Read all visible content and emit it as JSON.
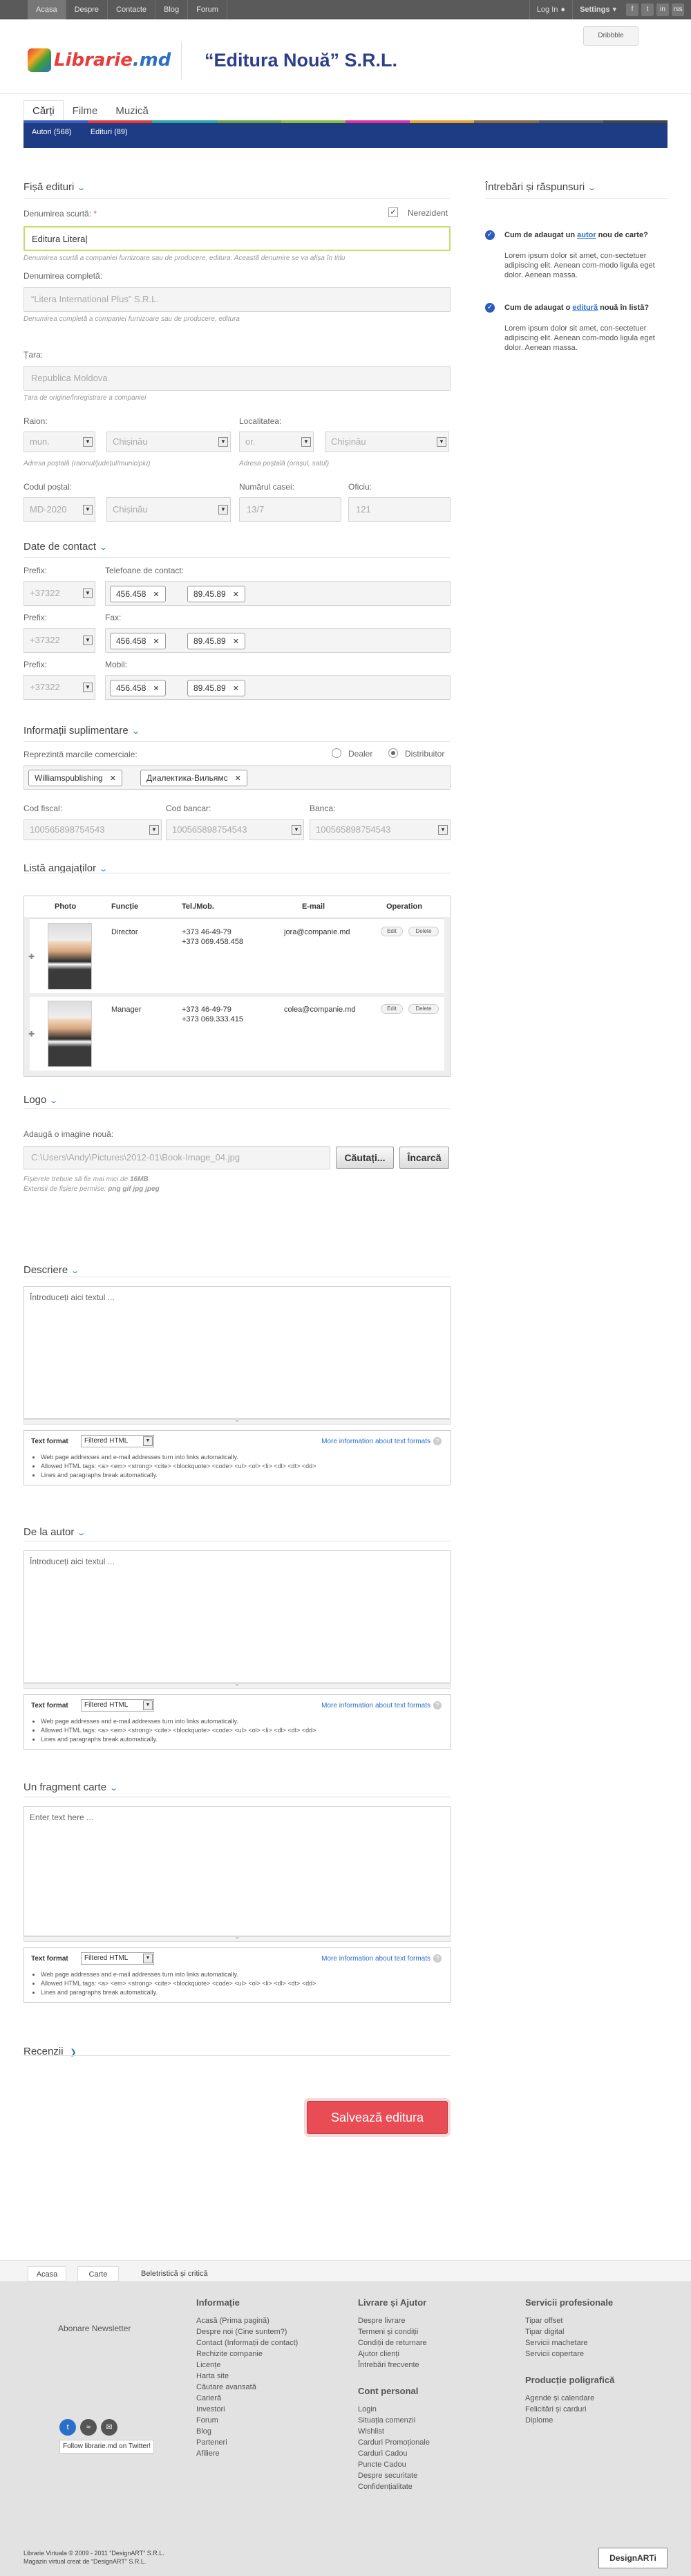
{
  "topnav": [
    "Acasa",
    "Despre",
    "Contacte",
    "Blog",
    "Forum"
  ],
  "topright": {
    "login": "Log In",
    "settings": "Settings",
    "social": [
      "f",
      "t",
      "in",
      "rss"
    ]
  },
  "dribbble": "Dribbble",
  "logo": {
    "a": "Librarie",
    "b": ".md"
  },
  "company": "“Editura Nouă” S.R.L.",
  "tabs": [
    "Cărți",
    "Filme",
    "Muzică"
  ],
  "colorstrip": [
    "#3a5fbf",
    "#e43c3c",
    "#2aa6a6",
    "#6aa544",
    "#8abf3a",
    "#e02fa5",
    "#e8a526",
    "#8b6a3e",
    "#5a5a5a",
    "#444444"
  ],
  "subtabs": [
    "Autori (568)",
    "Edituri (89)"
  ],
  "fisa": {
    "title": "Fișă edituri",
    "short_label": "Denumirea scurtă:",
    "required_mark": "*",
    "rezident": "Nerezident",
    "short_value": "Editura Litera",
    "short_help": "Denumirea scurtă a companiei furnizoare sau de producere, editura. Această denumire se va afișa în titlu",
    "full_label": "Denumirea completă:",
    "full_value": "“Litera International Plus” S.R.L.",
    "full_help": "Denumirea completă a companiei furnizoare sau de producere, editura",
    "country_label": "Țara:",
    "country_value": "Republica Moldova",
    "country_help": "Țara de origine/înregistrare a companiei",
    "raion_label": "Raion:",
    "raion_prefix": "mun.",
    "raion_value": "Chișinău",
    "raion_help": "Adresa poștală (raionul/județul/municipiu)",
    "loc_label": "Localitatea:",
    "loc_prefix": "or.",
    "loc_value": "Chișinău",
    "loc_help": "Adresa poștală (orașul, satul)",
    "postal_label": "Codul poștal:",
    "postal_value": "MD-2020",
    "postal_city": "Chișinău",
    "house_label": "Numărul casei:",
    "house_value": "13/7",
    "office_label": "Oficiu:",
    "office_value": "121"
  },
  "contact": {
    "title": "Date de contact",
    "rows": [
      {
        "prefix_label": "Prefix:",
        "field_label": "Telefoane de contact:",
        "prefix": "+37322",
        "tags": [
          "456.458",
          "89.45.89"
        ]
      },
      {
        "prefix_label": "Prefix:",
        "field_label": "Fax:",
        "prefix": "+37322",
        "tags": [
          "456.458",
          "89.45.89"
        ]
      },
      {
        "prefix_label": "Prefix:",
        "field_label": "Mobil:",
        "prefix": "+37322",
        "tags": [
          "456.458",
          "89.45.89"
        ]
      }
    ]
  },
  "extra": {
    "title": "Informații suplimentare",
    "brands_label": "Reprezintă marcile comerciale:",
    "dealer": "Dealer",
    "distribuitor": "Distribuitor",
    "brands": [
      "Williamspublishing",
      "Диалектика-Вильямс"
    ],
    "fiscal_label": "Cod fiscal:",
    "fiscal_value": "100565898754543",
    "bank_code_label": "Cod bancar:",
    "bank_code_value": "100565898754543",
    "bank_label": "Banca:",
    "bank_value": "100565898754543"
  },
  "employees": {
    "title": "Listă angajaților",
    "headers": [
      "Photo",
      "Funcție",
      "Tel./Mob.",
      "E-mail",
      "Operation"
    ],
    "rows": [
      {
        "role": "Director",
        "tel": "+373 46-49-79",
        "mob": "+373 069.458.458",
        "email": "jora@companie.md",
        "edit": "Edit",
        "delete": "Delete"
      },
      {
        "role": "Manager",
        "tel": "+373 46-49-79",
        "mob": "+373 069.333.415",
        "email": "colea@companie.md",
        "edit": "Edit",
        "delete": "Delete"
      }
    ]
  },
  "logo_sec": {
    "title": "Logo",
    "add_label": "Adaugă o imagine nouă:",
    "file_value": "C:\\Users\\Andy\\Pictures\\2012-01\\Book-Image_04.jpg",
    "browse": "Căutați...",
    "upload": "Încarcă",
    "help1": "Fișierele trebuie să fie mai mici de ",
    "help1_bold": "16MB",
    "help2": "Extensii de fișiere permise: ",
    "help2_bold": "png gif jpg jpeg"
  },
  "textformat": {
    "label": "Text format",
    "option": "Filtered HTML",
    "more": "More information about text formats",
    "help_icon": "?",
    "tips": [
      "Web page addresses and e-mail addresses turn into links automatically.",
      "Allowed HTML tags: <a> <em> <strong> <cite> <blockquote> <code> <ul> <ol> <li> <dl> <dt> <dd>",
      "Lines and paragraphs break automatically."
    ]
  },
  "descriere": {
    "title": "Descriere",
    "placeholder": "Întroduceți aici textul ..."
  },
  "autor": {
    "title": "De la autor",
    "placeholder": "Întroduceți aici textul ..."
  },
  "fragment": {
    "title": "Un fragment carte",
    "placeholder": "Enter text here ..."
  },
  "recenzii": {
    "title": "Recenzii"
  },
  "save": "Salvează editura",
  "sidebar": {
    "title": "Întrebări și răspunsuri",
    "items": [
      {
        "q1": "Cum de adaugat un ",
        "q_link": "autor",
        "q2": " nou de carte?",
        "a": "Lorem ipsum dolor sit amet, con-sectetuer adipiscing elit. Aenean com-modo ligula eget dolor. Aenean massa."
      },
      {
        "q1": "Cum de adaugat o ",
        "q_link": "editură",
        "q2": " nouă în listă?",
        "a": "Lorem ipsum dolor sit amet, con-sectetuer adipiscing elit. Aenean com-modo ligula eget dolor. Aenean massa."
      }
    ]
  },
  "breadcrumb": [
    "Acasa",
    "Carte",
    "Beletristică și critică"
  ],
  "footer": {
    "newsletter": "Abonare Newsletter",
    "follow_tip": "Follow librarie.md on Twitter!",
    "col1_title": "Informație",
    "col1": [
      "Acasă (Prima pagină)",
      "Despre noi (Cine suntem?)",
      "Contact (Informații de contact)",
      "Rechizite companie",
      "Licențe",
      "Harta site",
      "Căutare avansată",
      "Carieră",
      "Investori",
      "Forum",
      "Blog",
      "Parteneri",
      "Afiliere"
    ],
    "col2_title": "Livrare și Ajutor",
    "col2": [
      "Despre livrare",
      "Termeni și condiții",
      "Condiții de returnare",
      "Ajutor clienți",
      "Întrebări frecvente"
    ],
    "col2b_title": "Cont personal",
    "col2b": [
      "Login",
      "Situația comenzii",
      "Wishlist",
      "Carduri Promoționale",
      "Carduri Cadou",
      "Puncte Cadou",
      "Despre securitate",
      "Confidențialitate"
    ],
    "col3_title": "Servicii profesionale",
    "col3": [
      "Tipar offset",
      "Tipar digital",
      "Servicii machetare",
      "Servicii copertare"
    ],
    "col3b_title": "Producție poligrafică",
    "col3b": [
      "Agende și calendare",
      "Felicitări și carduri",
      "Diplome"
    ],
    "copyright1": "Librarie Virtuala © 2009 - 2011 “DesignART” S.R.L.",
    "copyright2": "Magazin virtual creat de “DesignART” S.R.L.",
    "brand": "DesignARTi"
  }
}
